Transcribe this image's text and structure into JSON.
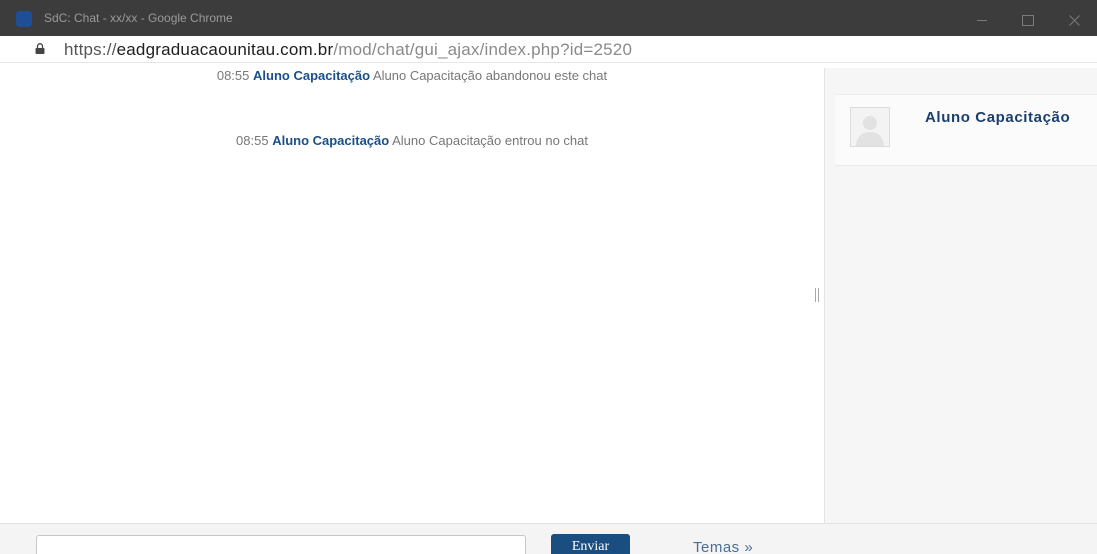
{
  "window": {
    "title": "SdC: Chat - xx/xx - Google Chrome"
  },
  "address": {
    "scheme": "https://",
    "domain": "eadgraduacaounitau.com.br",
    "path": "/mod/chat/gui_ajax/index.php?id=2520"
  },
  "messages": [
    {
      "time": "08:55",
      "user": "Aluno Capacitação",
      "text": "Aluno Capacitação abandonou este chat"
    },
    {
      "time": "08:55",
      "user": "Aluno Capacitação",
      "text": "Aluno Capacitação entrou no chat"
    }
  ],
  "users": [
    {
      "name": "Aluno Capacitação",
      "avatar_icon": "user-avatar-icon"
    }
  ],
  "composer": {
    "input_value": "",
    "send_label": "Enviar",
    "themes_label": "Temas »"
  },
  "colors": {
    "accent": "#1a4d80",
    "username": "#1a4f8a",
    "titlebar": "#3c3c3c"
  }
}
